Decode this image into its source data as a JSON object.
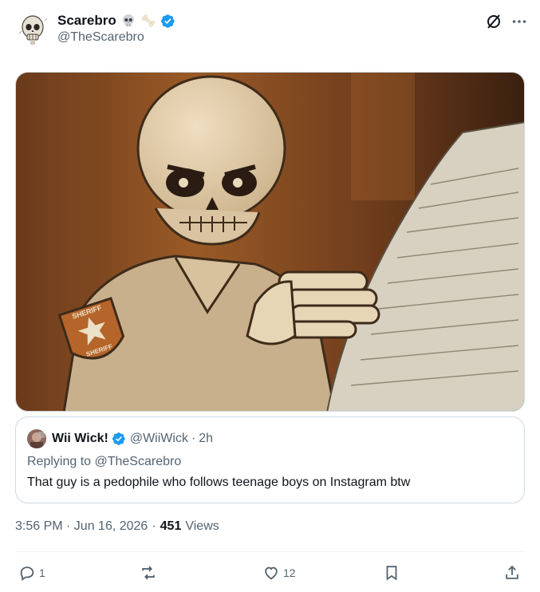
{
  "post": {
    "display_name": "Scarebro",
    "name_emojis": [
      "skull-emoji",
      "bone-emoji"
    ],
    "handle": "@TheScarebro",
    "verified": true,
    "timestamp": "3:56 PM · Jun 16, 2026",
    "views_count": "451",
    "views_label": "Views"
  },
  "media": {
    "description": "skeleton sheriff reading newspaper illustration",
    "badge_text_top": "SHERIFF",
    "badge_text_bottom": "SHERIFF"
  },
  "quote": {
    "display_name": "Wii Wick!",
    "handle": "@WiiWick",
    "time_sep": "·",
    "time": "2h",
    "replying_to": "Replying to @TheScarebro",
    "text": "That guy is a pedophile who follows teenage boys on Instagram btw"
  },
  "actions": {
    "reply_count": "1",
    "retweet_count": "",
    "like_count": "12"
  },
  "colors": {
    "text": "#0f1419",
    "secondary": "#536471",
    "verified": "#1d9bf0",
    "border": "#cfd9de"
  }
}
